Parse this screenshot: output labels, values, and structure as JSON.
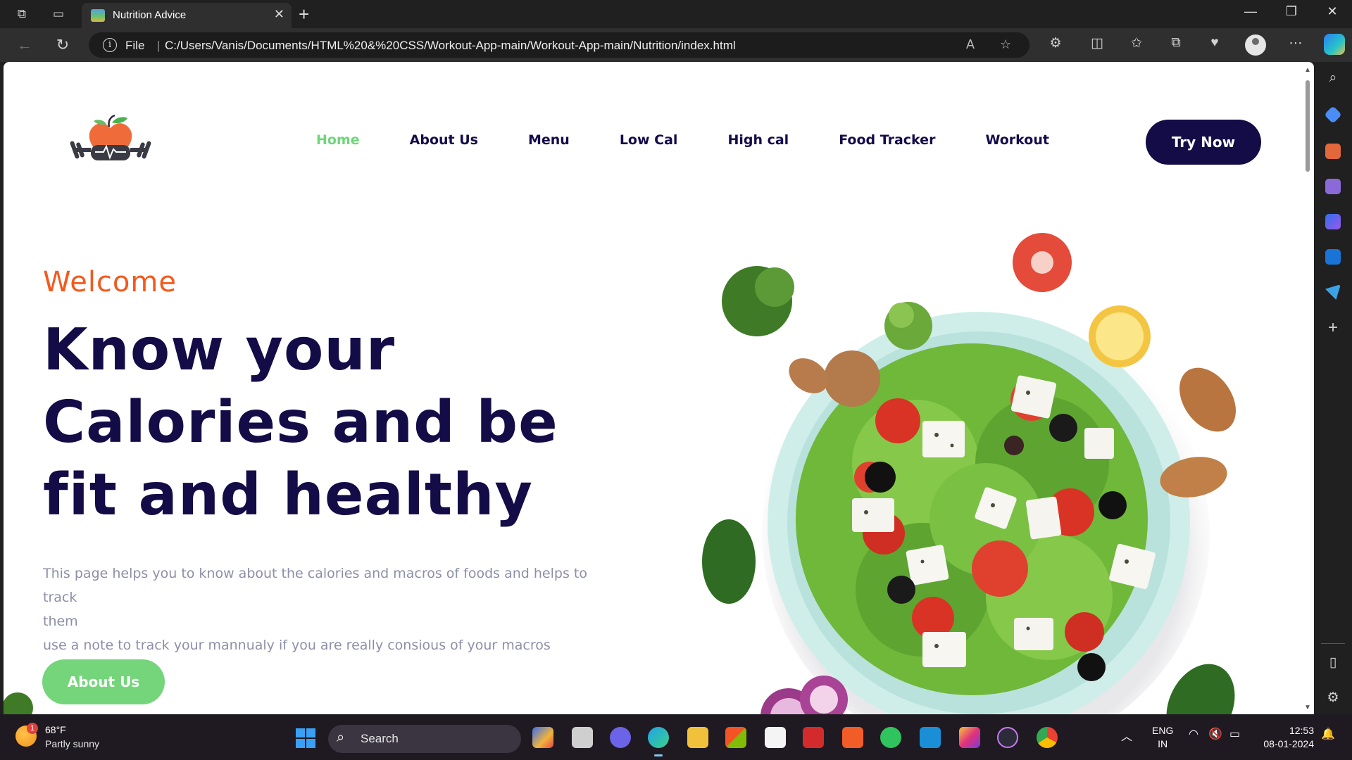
{
  "browser": {
    "tab_title": "Nutrition Advice",
    "tab_close": "✕",
    "new_tab": "+",
    "address_scheme": "File",
    "address_url": "C:/Users/Vanis/Documents/HTML%20&%20CSS/Workout-App-main/Workout-App-main/Nutrition/index.html",
    "window_controls": {
      "minimize": "—",
      "maximize": "❐",
      "close": "✕"
    }
  },
  "page": {
    "nav": {
      "links": [
        "Home",
        "About Us",
        "Menu",
        "Low Cal",
        "High cal",
        "Food Tracker",
        "Workout"
      ],
      "active_index": 0,
      "cta": "Try Now"
    },
    "hero": {
      "welcome": "Welcome",
      "headline_lines": [
        "Know your",
        "Calories and be",
        "fit and healthy"
      ],
      "description_lines": [
        "This page helps you to know about the calories and macros of foods and helps to track",
        "them",
        "use a note to track your mannualy if you are really consious of your macros"
      ],
      "button": "About Us"
    },
    "colors": {
      "brand_dark": "#130c47",
      "accent_green": "#74d57a",
      "accent_orange": "#f25a1e",
      "text_muted": "#8d8fa8"
    }
  },
  "taskbar": {
    "weather_temp": "68°F",
    "weather_desc": "Partly sunny",
    "weather_badge": "1",
    "search_placeholder": "Search",
    "lang_primary": "ENG",
    "lang_secondary": "IN",
    "time": "12:53",
    "date": "08-01-2024"
  }
}
